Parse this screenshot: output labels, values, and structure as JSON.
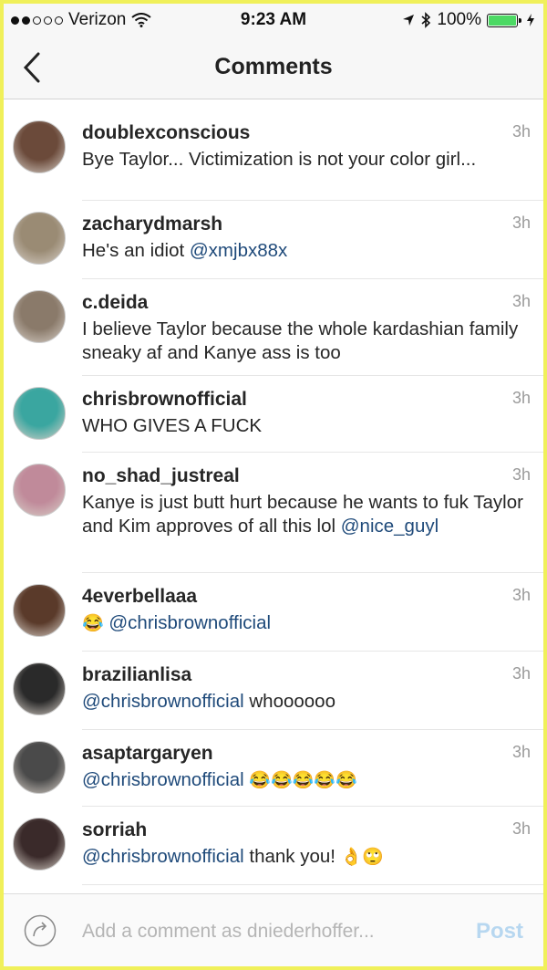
{
  "status_bar": {
    "carrier": "Verizon",
    "time": "9:23 AM",
    "battery": "100%",
    "signal_icons": [
      "signal-dots-icon",
      "wifi-icon"
    ],
    "right_icons": [
      "location-arrow-icon",
      "bluetooth-icon",
      "battery-icon",
      "charging-bolt-icon"
    ]
  },
  "nav": {
    "title": "Comments",
    "back_icon": "chevron-left-icon"
  },
  "comments": [
    {
      "username": "doublexconscious",
      "time": "3h",
      "parts": [
        {
          "t": "Bye Taylor... Victimization is not your color girl..."
        }
      ],
      "avatar_color": "#6b4a3a"
    },
    {
      "username": "zacharydmarsh",
      "time": "3h",
      "parts": [
        {
          "t": "He's an idiot "
        },
        {
          "t": "@xmjbx88x",
          "mention": true
        }
      ],
      "avatar_color": "#9a8b74"
    },
    {
      "username": "c.deida",
      "time": "3h",
      "parts": [
        {
          "t": "I believe Taylor because the whole kardashian family sneaky af and Kanye ass is too"
        }
      ],
      "avatar_color": "#8a7a6a"
    },
    {
      "username": "chrisbrownofficial",
      "time": "3h",
      "parts": [
        {
          "t": "WHO GIVES A FUCK"
        }
      ],
      "avatar_color": "#3aa6a0"
    },
    {
      "username": "no_shad_justreal",
      "time": "3h",
      "parts": [
        {
          "t": "Kanye is just butt hurt because he wants to fuk Taylor and  Kim approves of all  this lol "
        },
        {
          "t": "@nice_guyl",
          "mention": true
        }
      ],
      "avatar_color": "#c08a9a"
    },
    {
      "username": "4everbellaaa",
      "time": "3h",
      "parts": [
        {
          "t": "😂",
          "emoji": true
        },
        {
          "t": " "
        },
        {
          "t": "@chrisbrownofficial",
          "mention": true
        }
      ],
      "avatar_color": "#5a3a2a"
    },
    {
      "username": "brazilianlisa",
      "time": "3h",
      "parts": [
        {
          "t": "@chrisbrownofficial",
          "mention": true
        },
        {
          "t": " whoooooo"
        }
      ],
      "avatar_color": "#2a2a2a"
    },
    {
      "username": "asaptargaryen",
      "time": "3h",
      "parts": [
        {
          "t": "@chrisbrownofficial",
          "mention": true
        },
        {
          "t": " "
        },
        {
          "t": "😂😂😂😂😂",
          "emoji": true
        }
      ],
      "avatar_color": "#4a4a4a"
    },
    {
      "username": "sorriah",
      "time": "3h",
      "parts": [
        {
          "t": "@chrisbrownofficial",
          "mention": true
        },
        {
          "t": " thank you! "
        },
        {
          "t": "👌🙄",
          "emoji": true
        }
      ],
      "avatar_color": "#3a2a2a"
    }
  ],
  "composer": {
    "placeholder": "Add a comment as dniederhoffer...",
    "post_label": "Post",
    "icon": "rotate-share-icon"
  },
  "colors": {
    "mention": "#1f4a7a",
    "post_disabled": "#b7d7f0",
    "battery_green": "#4cd964",
    "outer_frame": "#f0f05a"
  }
}
